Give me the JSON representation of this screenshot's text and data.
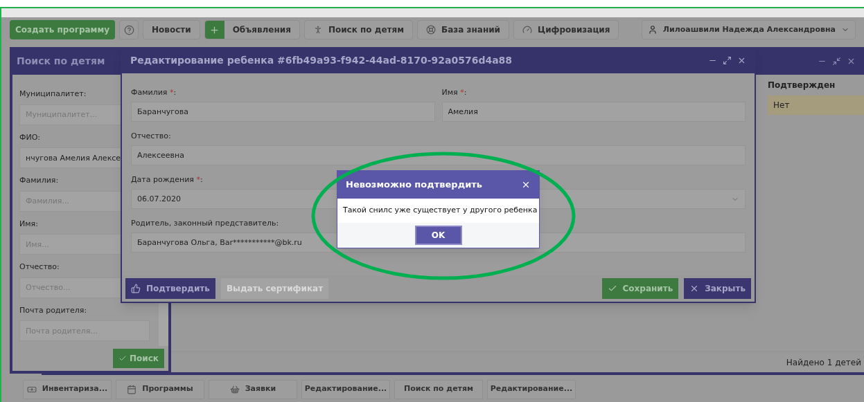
{
  "toolbar": {
    "buttons": [
      {
        "kind": "primary",
        "label": "Создать программу"
      },
      {
        "kind": "help"
      },
      {
        "kind": "text",
        "label": "Новости"
      },
      {
        "kind": "add",
        "label": "Объявления"
      },
      {
        "kind": "icon",
        "label": "Поиск по детям"
      },
      {
        "kind": "icon",
        "label": "База знаний"
      },
      {
        "kind": "icon",
        "label": "Цифровизация"
      }
    ],
    "user": "Лилоашвили Надежда Александровна"
  },
  "search_window": {
    "title": "Поиск по детям",
    "fields": [
      {
        "label": "Муниципалитет:",
        "placeholder": "Муниципалитет..."
      },
      {
        "label": "ФИО:",
        "value": "нчугова Амелия Алексе"
      },
      {
        "label": "Фамилия:",
        "placeholder": "Фамилия..."
      },
      {
        "label": "Имя:",
        "placeholder": "Имя..."
      },
      {
        "label": "Отчество:",
        "placeholder": "Отчество..."
      },
      {
        "label": "Почта родителя:",
        "placeholder": "Почта родителя..."
      }
    ],
    "search_button": "Поиск"
  },
  "results_window": {
    "columns": [
      "Подтвержден"
    ],
    "rows": [
      {
        "cells": [
          "Нет"
        ],
        "selected": true
      }
    ],
    "footer": "Найдено 1 детей"
  },
  "edit_dialog": {
    "title": "Редактирование ребенка #6fb49a93-f942-44ad-8170-92a0576d4a88",
    "rows": [
      [
        {
          "label": "Фамилия",
          "required_mark": "*",
          "suffix": ":",
          "value": "Баранчугова"
        },
        {
          "label": "Имя",
          "required_mark": "*",
          "suffix": ":",
          "value": "Амелия"
        }
      ],
      [
        {
          "label": "Отчество",
          "suffix": ":",
          "value": "Алексеевна"
        }
      ],
      [
        {
          "label": "Дата рождения",
          "required_mark": "*",
          "suffix": ":",
          "value": "06.07.2020"
        },
        {
          "kind": "select"
        }
      ],
      [
        {
          "label": "Родитель, законный представитель",
          "suffix": ":",
          "value": "Баранчугова Ольга, Bar***********@bk.ru"
        }
      ]
    ],
    "buttons": [
      {
        "kind": "confirm",
        "label": "Подтвердить",
        "disabled": false
      },
      {
        "kind": "plain",
        "label": "Выдать сертификат",
        "disabled": true
      },
      {
        "kind": "save",
        "label": "Сохранить",
        "disabled": false
      },
      {
        "kind": "close",
        "label": "Закрыть",
        "disabled": false
      }
    ]
  },
  "alert": {
    "title": "Невозможно подтвердить",
    "message": "Такой снилс уже существует у другого ребенка",
    "button": "OK"
  },
  "taskbar": [
    "Инвентариза...",
    "Программы",
    "Заявки",
    "Редактирование...",
    "Поиск по детям",
    "Редактирование..."
  ]
}
